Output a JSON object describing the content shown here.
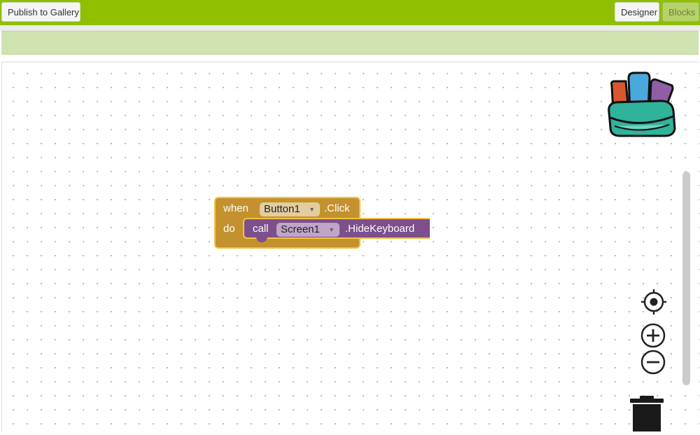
{
  "toolbar": {
    "publish_label": "Publish to Gallery",
    "designer_label": "Designer",
    "blocks_label": "Blocks"
  },
  "colors": {
    "toolbar_bg": "#8fbf00",
    "event_block": "#c3922e",
    "method_block": "#7d4f8c",
    "highlight_border": "#f5c240"
  },
  "blocks": {
    "event": {
      "when_label": "when",
      "component": "Button1",
      "event_name": ".Click",
      "do_label": "do"
    },
    "method_call": {
      "call_label": "call",
      "component": "Screen1",
      "method_name": ".HideKeyboard"
    }
  },
  "workspace_controls": {
    "backpack_icon": "backpack-icon",
    "recenter_icon": "crosshair-icon",
    "zoom_in_icon": "zoom-in-icon",
    "zoom_out_icon": "zoom-out-icon",
    "trash_icon": "trash-icon"
  }
}
